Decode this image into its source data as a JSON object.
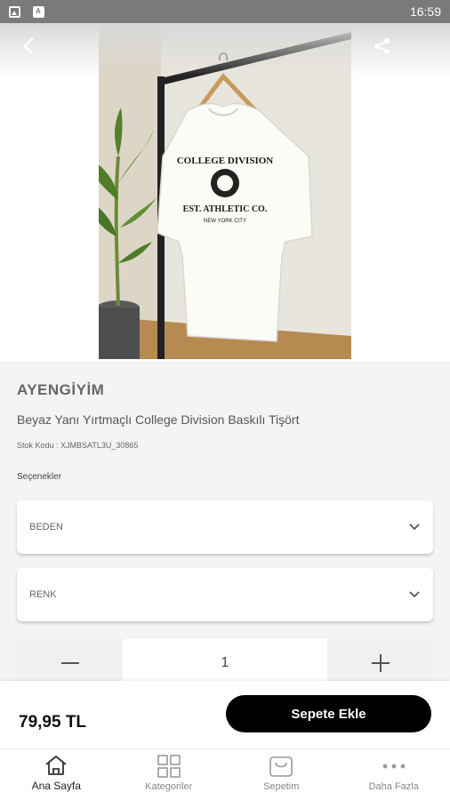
{
  "status_bar": {
    "time": "16:59",
    "icons": [
      "image-icon",
      "app-icon"
    ]
  },
  "header": {
    "back_icon": "chevron-left-icon",
    "share_icon": "share-icon"
  },
  "product": {
    "brand": "AYENGİYİM",
    "name": "Beyaz Yanı Yırtmaçlı College Division Baskılı Tişört",
    "stock_code": "Stok Kodu : XJMBSATL3U_30865",
    "options_title": "Seçenekler",
    "options": [
      {
        "label": "BEDEN"
      },
      {
        "label": "RENK"
      }
    ],
    "quantity": "1",
    "price": "79,95 TL",
    "add_to_cart": "Sepete Ekle",
    "print_line1": "COLLEGE DIVISION",
    "print_line2": "EST. ATHLETIC CO.",
    "print_line3": "NEW YORK CITY"
  },
  "bottom_nav": [
    {
      "label": "Ana Sayfa",
      "icon": "home-icon",
      "active": true
    },
    {
      "label": "Kategoriler",
      "icon": "grid-icon",
      "active": false
    },
    {
      "label": "Sepetim",
      "icon": "cart-icon",
      "active": false
    },
    {
      "label": "Daha Fazla",
      "icon": "more-icon",
      "active": false
    }
  ],
  "colors": {
    "accent": "#000000",
    "status_bar": "#7a7a7a",
    "background": "#f4f4f4"
  }
}
